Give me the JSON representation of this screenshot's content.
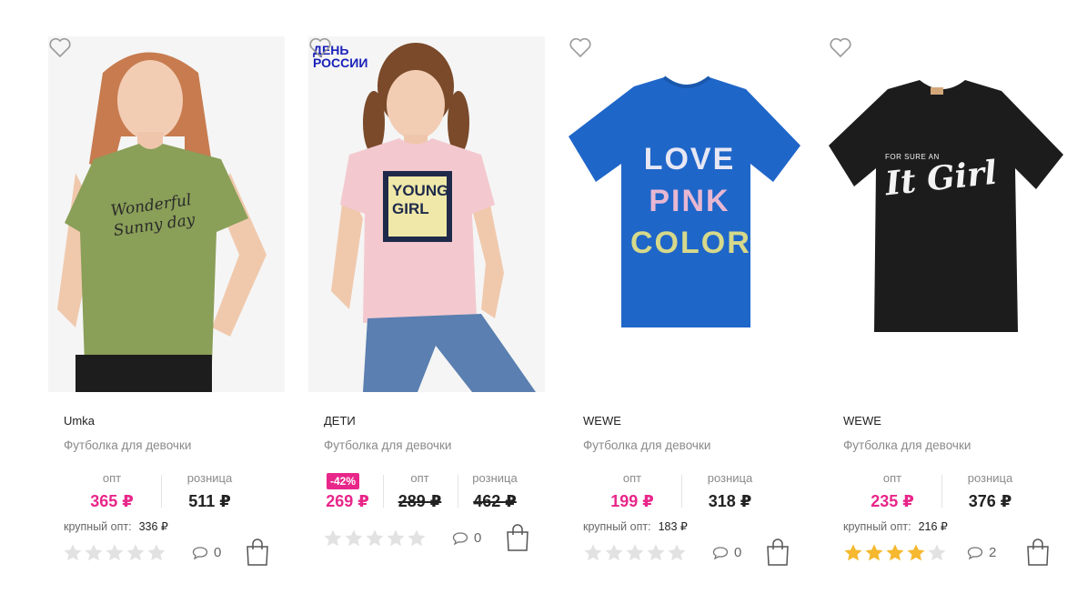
{
  "products": [
    {
      "brand": "Umka",
      "name": "Футболка для девочки",
      "opt_label": "опт",
      "opt_price": "365 ₽",
      "retail_label": "розница",
      "retail_price": "511 ₽",
      "bulk_label": "крупный опт:",
      "bulk_price": "336 ₽",
      "rating": 0,
      "comments": "0",
      "shirt_text": [
        "Wonderful",
        "Sunny day"
      ]
    },
    {
      "brand": "ДЕТИ",
      "name": "Футболка для девочки",
      "promo": "ДЕНЬ РОССИИ",
      "discount": "-42%",
      "sale_price": "269 ₽",
      "opt_label": "опт",
      "opt_old_price": "289 ₽",
      "retail_label": "розница",
      "retail_old_price": "462 ₽",
      "rating": 0,
      "comments": "0",
      "shirt_text": [
        "YOUNG",
        "GIRL"
      ]
    },
    {
      "brand": "WEWE",
      "name": "Футболка для девочки",
      "opt_label": "опт",
      "opt_price": "199 ₽",
      "retail_label": "розница",
      "retail_price": "318 ₽",
      "bulk_label": "крупный опт:",
      "bulk_price": "183 ₽",
      "rating": 0,
      "comments": "0",
      "shirt_text": [
        "LOVE",
        "PINK",
        "COLOR"
      ]
    },
    {
      "brand": "WEWE",
      "name": "Футболка для девочки",
      "opt_label": "опт",
      "opt_price": "235 ₽",
      "retail_label": "розница",
      "retail_price": "376 ₽",
      "bulk_label": "крупный опт:",
      "bulk_price": "216 ₽",
      "rating": 4,
      "comments": "2",
      "shirt_text": [
        "FOR SURE AN",
        "It Girl"
      ]
    }
  ],
  "icons": {
    "favorite": "heart-icon",
    "comments": "comment-bubble-icon",
    "cart": "shopping-bag-icon",
    "star": "star-icon"
  },
  "colors": {
    "accent": "#e8268a",
    "promo": "#1a22b8",
    "star_active": "#f5b82e",
    "star_inactive": "#e2e2e2"
  }
}
